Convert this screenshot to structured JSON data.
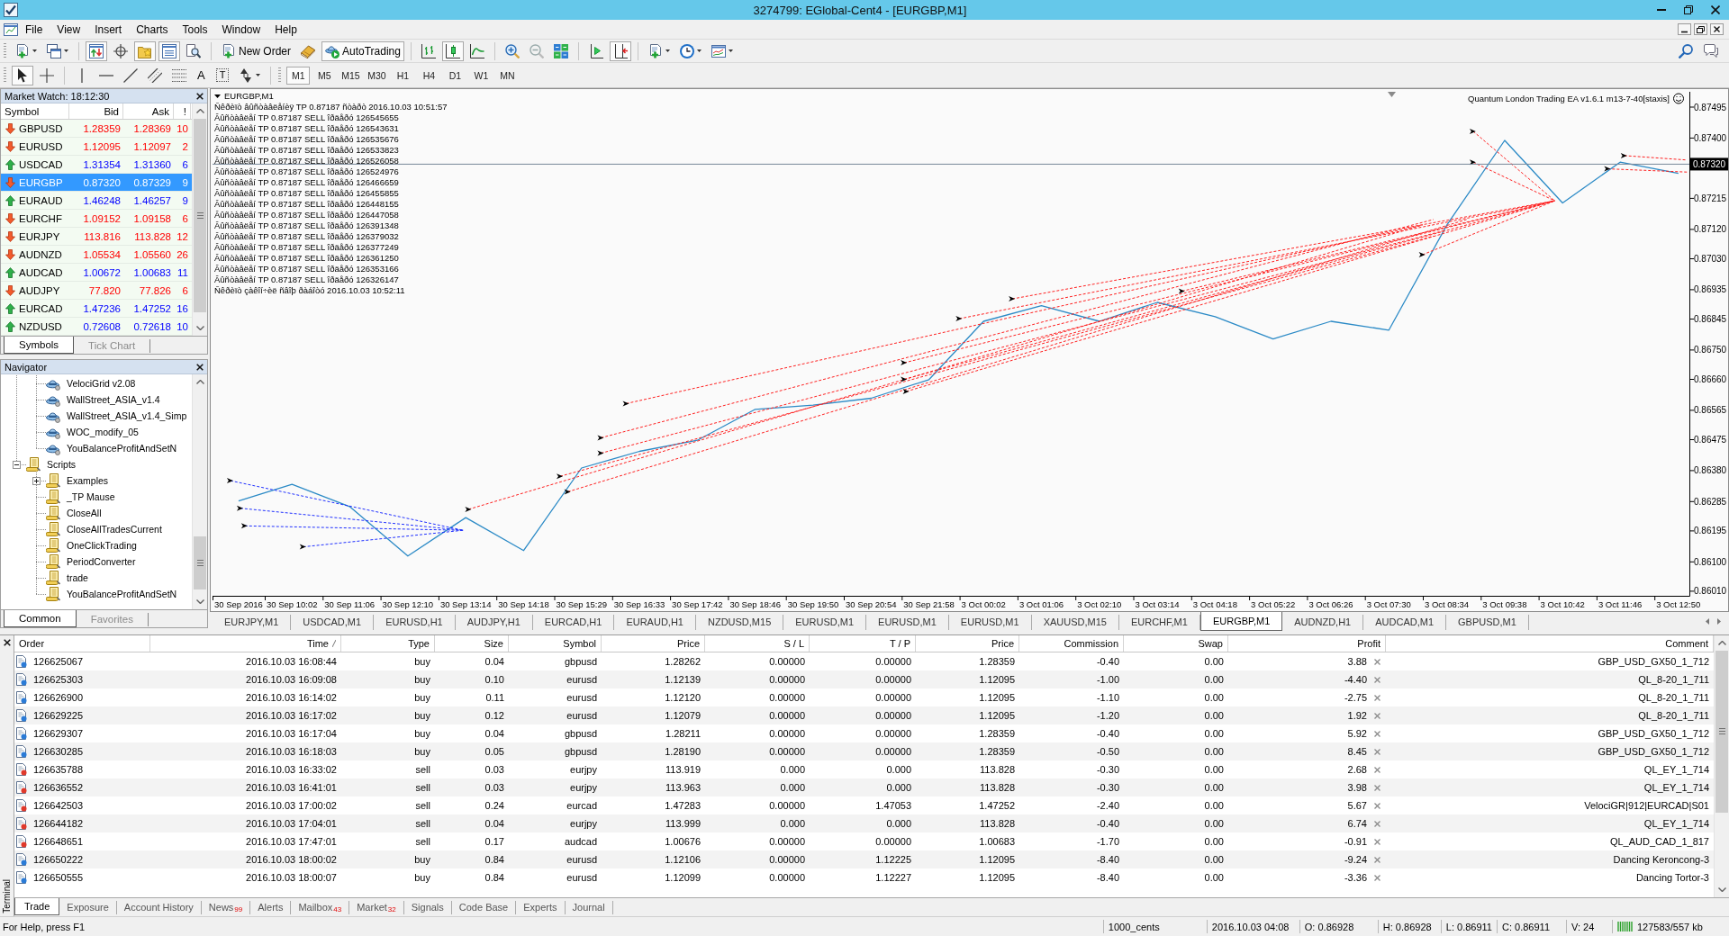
{
  "window": {
    "title": "3274799: EGlobal-Cent4 - [EURGBP,M1]"
  },
  "menu": [
    "File",
    "View",
    "Insert",
    "Charts",
    "Tools",
    "Window",
    "Help"
  ],
  "toolbar": {
    "view_buttons": [
      {
        "on": true
      },
      {
        "on": false
      },
      {
        "on": true
      },
      {
        "on": true
      },
      {
        "on": false
      }
    ],
    "new_order": "New Order",
    "auto_trading": {
      "label": "AutoTrading",
      "on": true
    },
    "chart_types": [
      {
        "selected": false
      },
      {
        "selected": true
      },
      {
        "selected": false
      }
    ],
    "chart_shift": {
      "on": false
    },
    "auto_scroll": {
      "on": true
    }
  },
  "drawing_toolbar": {
    "tools": [
      {
        "selected": true
      },
      {
        "selected": false
      }
    ],
    "text_tool": "A",
    "label_tool": "T",
    "timeframes": [
      {
        "label": "M1",
        "selected": true
      },
      {
        "label": "M5",
        "selected": false
      },
      {
        "label": "M15",
        "selected": false
      },
      {
        "label": "M30",
        "selected": false
      },
      {
        "label": "H1",
        "selected": false
      },
      {
        "label": "H4",
        "selected": false
      },
      {
        "label": "D1",
        "selected": false
      },
      {
        "label": "W1",
        "selected": false
      },
      {
        "label": "MN",
        "selected": false
      }
    ]
  },
  "market_watch": {
    "title": "Market Watch: 18:12:30",
    "columns": [
      "Symbol",
      "Bid",
      "Ask",
      "!"
    ],
    "rows": [
      {
        "kind": "down",
        "symbol": "GBPUSD",
        "bid": "1.28359",
        "ask": "1.28369",
        "spread": "10",
        "selected": false
      },
      {
        "kind": "down",
        "symbol": "EURUSD",
        "bid": "1.12095",
        "ask": "1.12097",
        "spread": "2",
        "selected": false
      },
      {
        "kind": "up",
        "symbol": "USDCAD",
        "bid": "1.31354",
        "ask": "1.31360",
        "spread": "6",
        "selected": false
      },
      {
        "kind": "down",
        "symbol": "EURGBP",
        "bid": "0.87320",
        "ask": "0.87329",
        "spread": "9",
        "selected": true
      },
      {
        "kind": "up",
        "symbol": "EURAUD",
        "bid": "1.46248",
        "ask": "1.46257",
        "spread": "9",
        "selected": false
      },
      {
        "kind": "down",
        "symbol": "EURCHF",
        "bid": "1.09152",
        "ask": "1.09158",
        "spread": "6",
        "selected": false
      },
      {
        "kind": "down",
        "symbol": "EURJPY",
        "bid": "113.816",
        "ask": "113.828",
        "spread": "12",
        "selected": false
      },
      {
        "kind": "down",
        "symbol": "AUDNZD",
        "bid": "1.05534",
        "ask": "1.05560",
        "spread": "26",
        "selected": false
      },
      {
        "kind": "up",
        "symbol": "AUDCAD",
        "bid": "1.00672",
        "ask": "1.00683",
        "spread": "11",
        "selected": false
      },
      {
        "kind": "down",
        "symbol": "AUDJPY",
        "bid": "77.820",
        "ask": "77.826",
        "spread": "6",
        "selected": false
      },
      {
        "kind": "up",
        "symbol": "EURCAD",
        "bid": "1.47236",
        "ask": "1.47252",
        "spread": "16",
        "selected": false
      },
      {
        "kind": "up",
        "symbol": "NZDUSD",
        "bid": "0.72608",
        "ask": "0.72618",
        "spread": "10",
        "selected": false
      }
    ],
    "tabs": [
      {
        "label": "Symbols",
        "selected": true
      },
      {
        "label": "Tick Chart",
        "selected": false
      }
    ]
  },
  "navigator": {
    "title": "Navigator",
    "tree": [
      {
        "children": [
          {
            "label": "VelociGrid v2.08",
            "kind": "expert"
          },
          {
            "label": "WallStreet_ASIA_v1.4",
            "kind": "expert"
          },
          {
            "label": "WallStreet_ASIA_v1.4_Simp",
            "kind": "expert"
          },
          {
            "label": "WOC_modify_05",
            "kind": "expert"
          },
          {
            "label": "YouBalanceProfitAndSetN",
            "kind": "expert"
          }
        ]
      },
      {
        "label": "Scripts",
        "kind": "folder",
        "expanded": true,
        "children": [
          {
            "label": "Examples",
            "kind": "folder",
            "expanded": false
          },
          {
            "label": "_TP Mause",
            "kind": "script"
          },
          {
            "label": "CloseAll",
            "kind": "script"
          },
          {
            "label": "CloseAllTradesCurrent",
            "kind": "script"
          },
          {
            "label": "OneClickTrading",
            "kind": "script"
          },
          {
            "label": "PeriodConverter",
            "kind": "script"
          },
          {
            "label": "trade",
            "kind": "script"
          },
          {
            "label": "YouBalanceProfitAndSetN",
            "kind": "script"
          }
        ]
      }
    ],
    "tabs": [
      {
        "label": "Common",
        "selected": true
      },
      {
        "label": "Favorites",
        "selected": false
      }
    ]
  },
  "chart": {
    "title": "EURGBP,M1",
    "comments": [
      "Ñêðèïò âûñòàâëåíèÿ TP 0.87187 ñòàðò 2016.10.03 10:51:57",
      "Âûñòàâëåí TP 0.87187 SELL îðäåðó 126545655",
      "Âûñòàâëåí TP 0.87187 SELL îðäåðó 126543631",
      "Âûñòàâëåí TP 0.87187 SELL îðäåðó 126535676",
      "Âûñòàâëåí TP 0.87187 SELL îðäåðó 126533823",
      "Âûñòàâëåí TP 0.87187 SELL îðäåðó 126526058",
      "Âûñòàâëåí TP 0.87187 SELL îðäåðó 126524976",
      "Âûñòàâëåí TP 0.87187 SELL îðäåðó 126466659",
      "Âûñòàâëåí TP 0.87187 SELL îðäåðó 126455855",
      "Âûñòàâëåí TP 0.87187 SELL îðäåðó 126448155",
      "Âûñòàâëåí TP 0.87187 SELL îðäåðó 126447058",
      "Âûñòàâëåí TP 0.87187 SELL îðäåðó 126391348",
      "Âûñòàâëåí TP 0.87187 SELL îðäåðó 126379032",
      "Âûñòàâëåí TP 0.87187 SELL îðäåðó 126377249",
      "Âûñòàâëåí TP 0.87187 SELL îðäåðó 126361250",
      "Âûñòàâëåí TP 0.87187 SELL îðäåðó 126353166",
      "Âûñòàâëåí TP 0.87187 SELL îðäåðó 126326147",
      "Ñêðèïò çàêîí÷èë ñâîþ ðàáîòó 2016.10.03 10:52:11"
    ],
    "expert": "Quantum London Trading EA v1.6.1 m13-7-40[staxis]",
    "chart_data": [
      {
        "type": "line",
        "categories": [
          "30 Sep 2016",
          "30 Sep 10:02",
          "30 Sep 11:06",
          "30 Sep 12:10",
          "30 Sep 13:14",
          "30 Sep 14:18",
          "30 Sep 15:29",
          "30 Sep 16:33",
          "30 Sep 17:42",
          "30 Sep 18:46",
          "30 Sep 19:50",
          "30 Sep 20:54",
          "30 Sep 21:58",
          "3 Oct 00:02",
          "3 Oct 01:06",
          "3 Oct 02:10",
          "3 Oct 03:14",
          "3 Oct 04:18",
          "3 Oct 05:22",
          "3 Oct 06:26",
          "3 Oct 07:30",
          "3 Oct 08:34",
          "3 Oct 09:38",
          "3 Oct 10:42",
          "3 Oct 11:46",
          "3 Oct 12:50"
        ],
        "values": [
          0.86287,
          0.86338,
          0.8627,
          0.86118,
          0.86236,
          0.86135,
          0.86388,
          0.86439,
          0.86473,
          0.86568,
          0.86581,
          0.86602,
          0.86659,
          0.86838,
          0.86886,
          0.86838,
          0.86896,
          0.86852,
          0.86784,
          0.86838,
          0.86811,
          0.87133,
          0.87393,
          0.87201,
          0.87326,
          0.87292
        ],
        "color": "#2b8ac6",
        "yticks": [
          {
            "value": 0.8601,
            "label": "0.86010"
          },
          {
            "value": 0.861,
            "label": "0.86100"
          },
          {
            "value": 0.86195,
            "label": "0.86195"
          },
          {
            "value": 0.86285,
            "label": "0.86285"
          },
          {
            "value": 0.8638,
            "label": "0.86380"
          },
          {
            "value": 0.86475,
            "label": "0.86475"
          },
          {
            "value": 0.86565,
            "label": "0.86565"
          },
          {
            "value": 0.8666,
            "label": "0.86660"
          },
          {
            "value": 0.8675,
            "label": "0.86750"
          },
          {
            "value": 0.86845,
            "label": "0.86845"
          },
          {
            "value": 0.86935,
            "label": "0.86935"
          },
          {
            "value": 0.8703,
            "label": "0.87030"
          },
          {
            "value": 0.8712,
            "label": "0.87120"
          },
          {
            "value": 0.87215,
            "label": "0.87215"
          },
          {
            "value": 0.874,
            "label": "0.87400"
          },
          {
            "value": 0.87495,
            "label": "0.87495"
          }
        ],
        "ylim": [
          0.85996,
          0.87542
        ],
        "ref_lines": [
          {
            "axis": "y",
            "value": 0.8732,
            "label": "0.87320",
            "color": "#778899"
          }
        ]
      }
    ]
  },
  "chart_tabs": [
    {
      "label": "EURJPY,M1",
      "selected": false
    },
    {
      "label": "USDCAD,M1",
      "selected": false
    },
    {
      "label": "EURUSD,H1",
      "selected": false
    },
    {
      "label": "AUDJPY,H1",
      "selected": false
    },
    {
      "label": "EURCAD,H1",
      "selected": false
    },
    {
      "label": "EURAUD,H1",
      "selected": false
    },
    {
      "label": "NZDUSD,M15",
      "selected": false
    },
    {
      "label": "EURUSD,M1",
      "selected": false
    },
    {
      "label": "EURUSD,M1",
      "selected": false
    },
    {
      "label": "EURUSD,M1",
      "selected": false
    },
    {
      "label": "XAUUSD,M15",
      "selected": false
    },
    {
      "label": "EURCHF,M1",
      "selected": false
    },
    {
      "label": "EURGBP,M1",
      "selected": true
    },
    {
      "label": "AUDNZD,H1",
      "selected": false
    },
    {
      "label": "AUDCAD,M1",
      "selected": false
    },
    {
      "label": "GBPUSD,M1",
      "selected": false
    }
  ],
  "terminal": {
    "title": "Terminal",
    "columns": [
      {
        "label": "Order",
        "sorted": false
      },
      {
        "label": "Time",
        "sorted": true
      },
      {
        "label": "Type",
        "sorted": false
      },
      {
        "label": "Size",
        "sorted": false
      },
      {
        "label": "Symbol",
        "sorted": false
      },
      {
        "label": "Price",
        "sorted": false
      },
      {
        "label": "S / L",
        "sorted": false
      },
      {
        "label": "T / P",
        "sorted": false
      },
      {
        "label": "Price",
        "sorted": false
      },
      {
        "label": "Commission",
        "sorted": false
      },
      {
        "label": "Swap",
        "sorted": false
      },
      {
        "label": "Profit",
        "sorted": false
      },
      {
        "label": "Comment",
        "sorted": false
      }
    ],
    "rows": [
      {
        "kind": "buy",
        "order": "126625067",
        "time": "2016.10.03 16:08:44",
        "type": "buy",
        "size": "0.04",
        "symbol": "gbpusd",
        "price": "1.28262",
        "sl": "0.00000",
        "tp": "0.00000",
        "current_price": "1.28359",
        "commission": "-0.40",
        "swap": "0.00",
        "profit": "3.88",
        "comment": "GBP_USD_GX50_1_712"
      },
      {
        "kind": "buy",
        "order": "126625303",
        "time": "2016.10.03 16:09:08",
        "type": "buy",
        "size": "0.10",
        "symbol": "eurusd",
        "price": "1.12139",
        "sl": "0.00000",
        "tp": "0.00000",
        "current_price": "1.12095",
        "commission": "-1.00",
        "swap": "0.00",
        "profit": "-4.40",
        "comment": "QL_8-20_1_711"
      },
      {
        "kind": "buy",
        "order": "126626900",
        "time": "2016.10.03 16:14:02",
        "type": "buy",
        "size": "0.11",
        "symbol": "eurusd",
        "price": "1.12120",
        "sl": "0.00000",
        "tp": "0.00000",
        "current_price": "1.12095",
        "commission": "-1.10",
        "swap": "0.00",
        "profit": "-2.75",
        "comment": "QL_8-20_1_711"
      },
      {
        "kind": "buy",
        "order": "126629225",
        "time": "2016.10.03 16:17:02",
        "type": "buy",
        "size": "0.12",
        "symbol": "eurusd",
        "price": "1.12079",
        "sl": "0.00000",
        "tp": "0.00000",
        "current_price": "1.12095",
        "commission": "-1.20",
        "swap": "0.00",
        "profit": "1.92",
        "comment": "QL_8-20_1_711"
      },
      {
        "kind": "buy",
        "order": "126629307",
        "time": "2016.10.03 16:17:04",
        "type": "buy",
        "size": "0.04",
        "symbol": "gbpusd",
        "price": "1.28211",
        "sl": "0.00000",
        "tp": "0.00000",
        "current_price": "1.28359",
        "commission": "-0.40",
        "swap": "0.00",
        "profit": "5.92",
        "comment": "GBP_USD_GX50_1_712"
      },
      {
        "kind": "buy",
        "order": "126630285",
        "time": "2016.10.03 16:18:03",
        "type": "buy",
        "size": "0.05",
        "symbol": "gbpusd",
        "price": "1.28190",
        "sl": "0.00000",
        "tp": "0.00000",
        "current_price": "1.28359",
        "commission": "-0.50",
        "swap": "0.00",
        "profit": "8.45",
        "comment": "GBP_USD_GX50_1_712"
      },
      {
        "kind": "sell",
        "order": "126635788",
        "time": "2016.10.03 16:33:02",
        "type": "sell",
        "size": "0.03",
        "symbol": "eurjpy",
        "price": "113.919",
        "sl": "0.000",
        "tp": "0.000",
        "current_price": "113.828",
        "commission": "-0.30",
        "swap": "0.00",
        "profit": "2.68",
        "comment": "QL_EY_1_714"
      },
      {
        "kind": "sell",
        "order": "126636552",
        "time": "2016.10.03 16:41:01",
        "type": "sell",
        "size": "0.03",
        "symbol": "eurjpy",
        "price": "113.963",
        "sl": "0.000",
        "tp": "0.000",
        "current_price": "113.828",
        "commission": "-0.30",
        "swap": "0.00",
        "profit": "3.98",
        "comment": "QL_EY_1_714"
      },
      {
        "kind": "sell",
        "order": "126642503",
        "time": "2016.10.03 17:00:02",
        "type": "sell",
        "size": "0.24",
        "symbol": "eurcad",
        "price": "1.47283",
        "sl": "0.00000",
        "tp": "1.47053",
        "current_price": "1.47252",
        "commission": "-2.40",
        "swap": "0.00",
        "profit": "5.67",
        "comment": "VelociGR|912|EURCAD|S01"
      },
      {
        "kind": "sell",
        "order": "126644182",
        "time": "2016.10.03 17:04:01",
        "type": "sell",
        "size": "0.04",
        "symbol": "eurjpy",
        "price": "113.999",
        "sl": "0.000",
        "tp": "0.000",
        "current_price": "113.828",
        "commission": "-0.40",
        "swap": "0.00",
        "profit": "6.74",
        "comment": "QL_EY_1_714"
      },
      {
        "kind": "sell",
        "order": "126648651",
        "time": "2016.10.03 17:47:01",
        "type": "sell",
        "size": "0.17",
        "symbol": "audcad",
        "price": "1.00676",
        "sl": "0.00000",
        "tp": "0.00000",
        "current_price": "1.00683",
        "commission": "-1.70",
        "swap": "0.00",
        "profit": "-0.91",
        "comment": "QL_AUD_CAD_1_817"
      },
      {
        "kind": "buy",
        "order": "126650222",
        "time": "2016.10.03 18:00:02",
        "type": "buy",
        "size": "0.84",
        "symbol": "eurusd",
        "price": "1.12106",
        "sl": "0.00000",
        "tp": "1.12225",
        "current_price": "1.12095",
        "commission": "-8.40",
        "swap": "0.00",
        "profit": "-9.24",
        "comment": "Dancing Keroncong-3"
      },
      {
        "kind": "buy",
        "order": "126650555",
        "time": "2016.10.03 18:00:07",
        "type": "buy",
        "size": "0.84",
        "symbol": "eurusd",
        "price": "1.12099",
        "sl": "0.00000",
        "tp": "1.12227",
        "current_price": "1.12095",
        "commission": "-8.40",
        "swap": "0.00",
        "profit": "-3.36",
        "comment": "Dancing Tortor-3"
      }
    ],
    "tabs": [
      {
        "label": "Trade",
        "selected": true
      },
      {
        "label": "Exposure",
        "selected": false
      },
      {
        "label": "Account History",
        "selected": false
      },
      {
        "label": "News",
        "count": "99",
        "selected": false
      },
      {
        "label": "Alerts",
        "selected": false
      },
      {
        "label": "Mailbox",
        "count": "43",
        "selected": false
      },
      {
        "label": "Market",
        "count": "32",
        "selected": false
      },
      {
        "label": "Signals",
        "selected": false
      },
      {
        "label": "Code Base",
        "selected": false
      },
      {
        "label": "Experts",
        "selected": false
      },
      {
        "label": "Journal",
        "selected": false
      }
    ]
  },
  "status_bar": {
    "help": "For Help, press F1",
    "profile": "1000_cents",
    "time": "2016.10.03 04:08",
    "open": "O: 0.86928",
    "high": "H: 0.86928",
    "low": "L: 0.86911",
    "close": "C: 0.86911",
    "volume": "V: 24",
    "traffic": "127583/557 kb"
  }
}
